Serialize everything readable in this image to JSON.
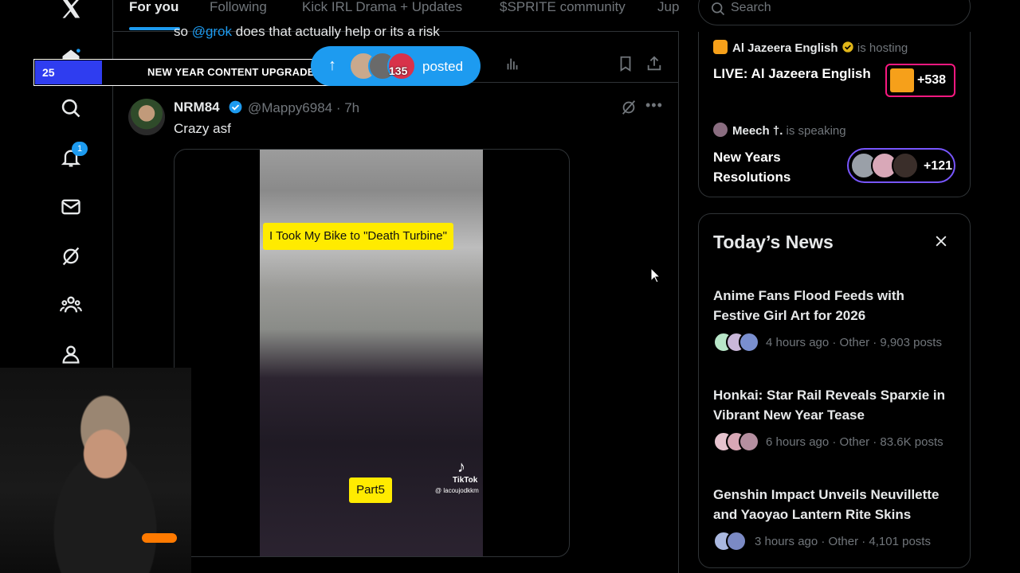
{
  "nav": {
    "items": [
      {
        "name": "x-logo"
      },
      {
        "name": "home"
      },
      {
        "name": "explore"
      },
      {
        "name": "notifications",
        "badge": "1"
      },
      {
        "name": "messages"
      },
      {
        "name": "grok"
      },
      {
        "name": "communities"
      },
      {
        "name": "profile"
      }
    ]
  },
  "feed": {
    "tabs": [
      "For you",
      "Following",
      "Kick IRL Drama + Updates",
      "$SPRITE community",
      "Jup"
    ],
    "active_tab": "For you",
    "prev_post_text_before": "so ",
    "prev_post_mention": "@grok",
    "prev_post_text_after": " does that actually help or its a risk"
  },
  "overlay": {
    "count": "25",
    "label": "NEW YEAR CONTENT UPGRADE",
    "posted_count": "135",
    "posted_label": "posted"
  },
  "tweet": {
    "name": "NRM84",
    "handle_time": "@Mappy6984 · 7h",
    "text": "Crazy asf",
    "video_caption": "I Took My Bike to \"Death Turbine\"",
    "video_part": "Part5",
    "watermark": "TikTok",
    "watermark_user": "@ lacoujodkkm"
  },
  "search": {
    "placeholder": "Search"
  },
  "spaces": [
    {
      "host": "Al Jazeera English",
      "status": "is hosting",
      "title": "LIVE: Al Jazeera English",
      "count": "+538"
    },
    {
      "host": "Meech †.",
      "status": "is speaking",
      "title_line1": "New Years",
      "title_line2": "Resolutions",
      "count": "+121"
    }
  ],
  "news": {
    "title": "Today’s News",
    "items": [
      {
        "title_line1": "Anime Fans Flood Feeds with",
        "title_line2": "Festive Girl Art for 2026",
        "meta": "4 hours ago · Other · 9,903 posts"
      },
      {
        "title_line1": "Honkai: Star Rail Reveals Sparxie in",
        "title_line2": "Vibrant New Year Tease",
        "meta": "6 hours ago · Other · 83.6K posts"
      },
      {
        "title_line1": "Genshin Impact Unveils Neuvillette",
        "title_line2": "and Yaoyao Lantern Rite Skins",
        "meta": "3 hours ago · Other · 4,101 posts"
      }
    ]
  },
  "colors": {
    "accent": "#1d9bf0",
    "muted": "#71767b",
    "border": "#2f3336",
    "caption_yellow": "#ffeb00",
    "space_pink": "#f91880",
    "space_purple": "#7856ff"
  }
}
